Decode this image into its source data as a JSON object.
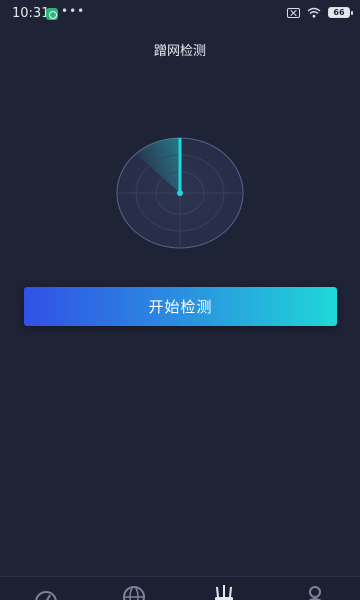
{
  "status_bar": {
    "time": "10:31",
    "dots": "•••",
    "battery": "66"
  },
  "header": {
    "title": "蹭网检测"
  },
  "main": {
    "start_button_label": "开始检测"
  },
  "colors": {
    "background": "#1f2336",
    "accent": "#1fd8d8",
    "button_gradient_start": "#3150e6",
    "button_gradient_end": "#1fd8d8"
  },
  "bottom_nav": {
    "items": [
      {
        "icon": "speedometer-icon"
      },
      {
        "icon": "globe-icon"
      },
      {
        "icon": "router-icon"
      },
      {
        "icon": "profile-icon"
      }
    ]
  }
}
